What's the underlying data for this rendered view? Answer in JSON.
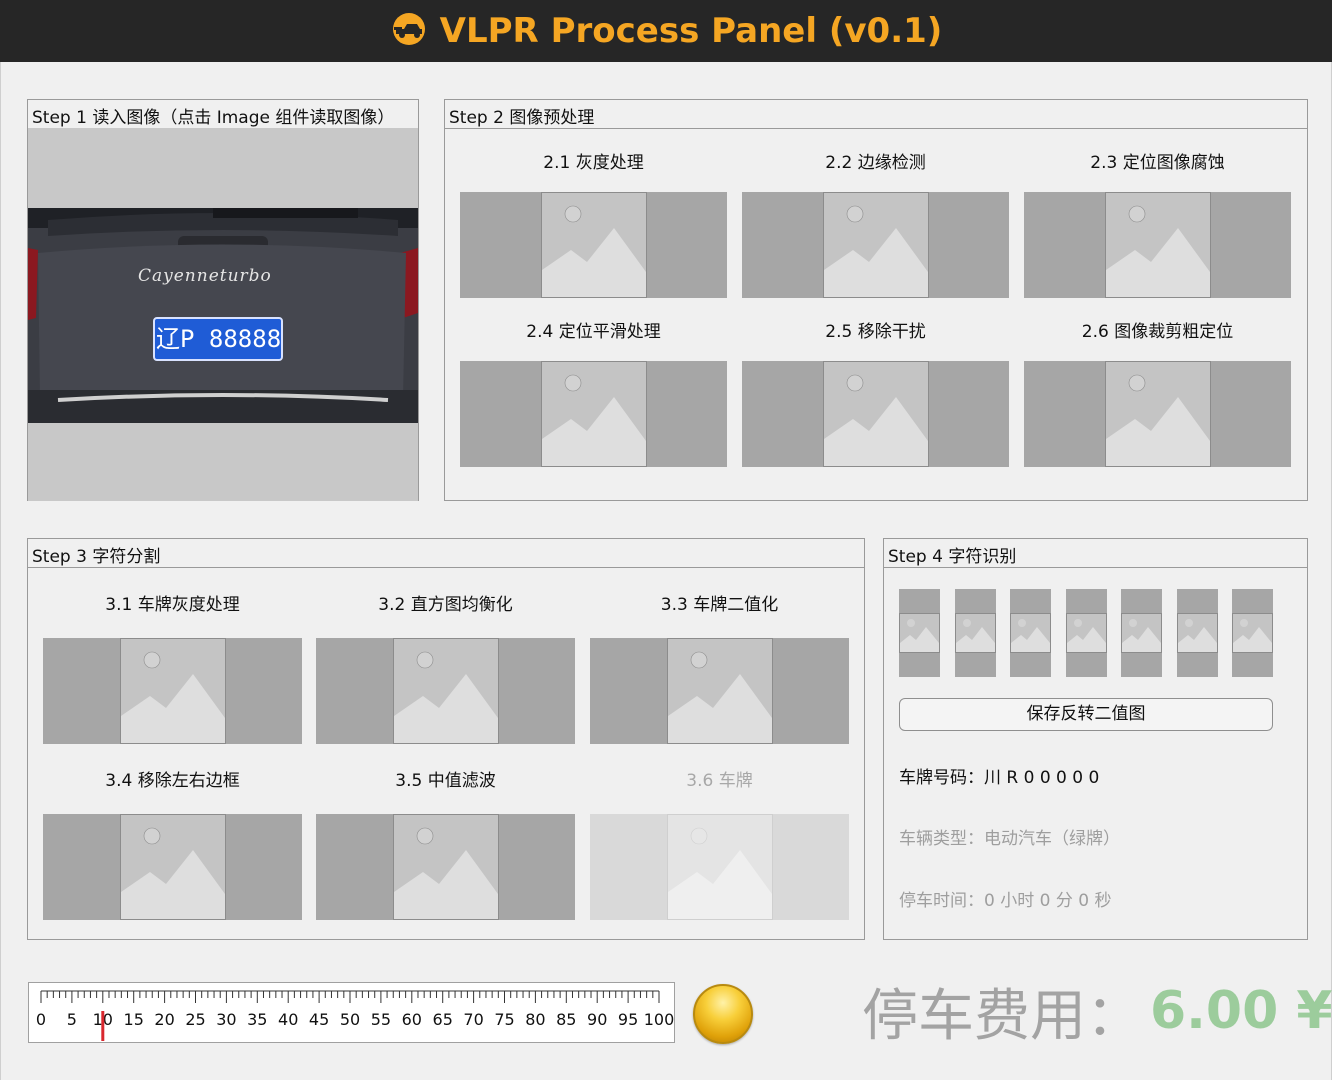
{
  "app": {
    "title": "VLPR Process Panel (v0.1)",
    "title_color": "#f5a623",
    "logo_icon": "car-icon"
  },
  "step1": {
    "title": "Step 1 读入图像（点击 Image 组件读取图像）",
    "image": {
      "badge_text": "Cayenneturbo",
      "plate_text": "辽P 88888"
    }
  },
  "step2": {
    "title": "Step 2 图像预处理",
    "items": [
      {
        "label": "2.1 灰度处理"
      },
      {
        "label": "2.2 边缘检测"
      },
      {
        "label": "2.3 定位图像腐蚀"
      },
      {
        "label": "2.4 定位平滑处理"
      },
      {
        "label": "2.5 移除干扰"
      },
      {
        "label": "2.6 图像裁剪粗定位"
      }
    ]
  },
  "step3": {
    "title": "Step 3 字符分割",
    "items": [
      {
        "label": "3.1 车牌灰度处理",
        "enabled": true
      },
      {
        "label": "3.2 直方图均衡化",
        "enabled": true
      },
      {
        "label": "3.3 车牌二值化",
        "enabled": true
      },
      {
        "label": "3.4 移除左右边框",
        "enabled": true
      },
      {
        "label": "3.5 中值滤波",
        "enabled": true
      },
      {
        "label": "3.6 车牌",
        "enabled": false
      }
    ]
  },
  "step4": {
    "title": "Step 4 字符识别",
    "char_slots": 7,
    "save_button": "保存反转二值图",
    "plate_number": "车牌号码：川 R 0 0 0 0 0",
    "vehicle_type": "车辆类型：电动汽车（绿牌）",
    "parking_time": "停车时间：0 小时 0 分 0 秒"
  },
  "ruler": {
    "labels": [
      "0",
      "5",
      "10",
      "15",
      "20",
      "25",
      "30",
      "35",
      "40",
      "45",
      "50",
      "55",
      "60",
      "65",
      "70",
      "75",
      "80",
      "85",
      "90",
      "95",
      "100"
    ],
    "min": 0,
    "max": 100,
    "value": 10,
    "needle_color": "#d9272e"
  },
  "lamp": {
    "state": "on",
    "color": "#f8cf3a"
  },
  "fee": {
    "label": "停车费用：",
    "value": "6.00 ¥",
    "value_color": "#9ccc9c"
  }
}
